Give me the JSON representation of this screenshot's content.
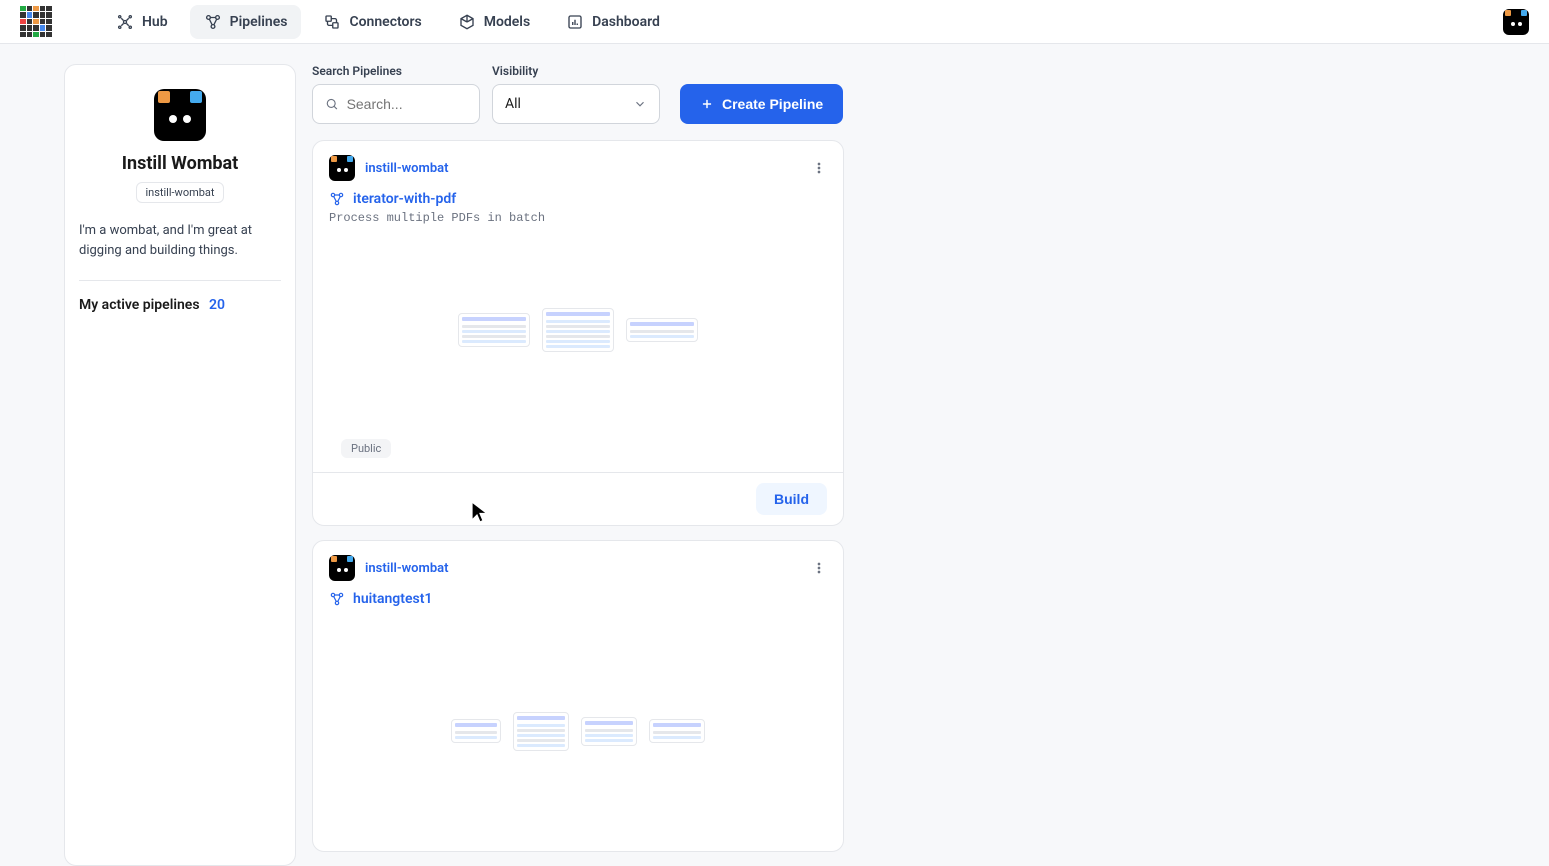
{
  "nav": {
    "hub": "Hub",
    "pipelines": "Pipelines",
    "connectors": "Connectors",
    "models": "Models",
    "dashboard": "Dashboard"
  },
  "profile": {
    "display_name": "Instill Wombat",
    "handle": "instill-wombat",
    "bio": "I'm a wombat, and I'm great at digging and building things.",
    "stats_label": "My active pipelines",
    "stats_count": "20"
  },
  "filters": {
    "search_label": "Search Pipelines",
    "search_placeholder": "Search...",
    "visibility_label": "Visibility",
    "visibility_value": "All",
    "create_label": "Create Pipeline"
  },
  "cards": [
    {
      "owner": "instill-wombat",
      "name": "iterator-with-pdf",
      "description": "Process multiple PDFs in batch",
      "visibility": "Public",
      "build_label": "Build"
    },
    {
      "owner": "instill-wombat",
      "name": "huitangtest1",
      "description": ""
    }
  ]
}
